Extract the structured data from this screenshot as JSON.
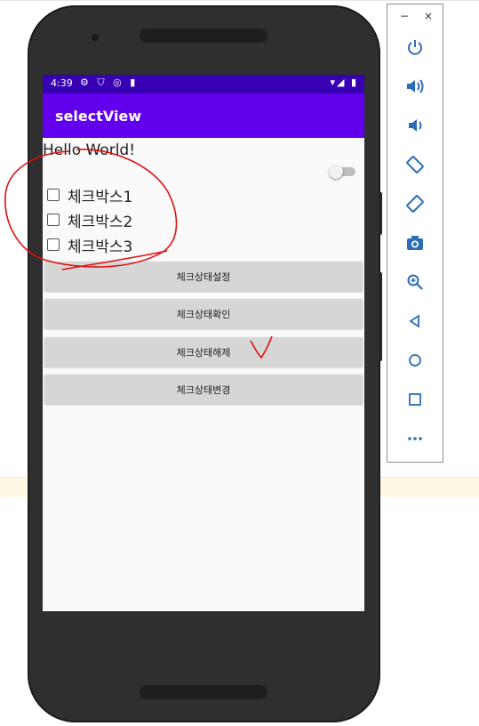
{
  "status_bar": {
    "time": "4:39",
    "left_icons": "⚙ ⛉ ◎ ▮",
    "right_icons": "▾◢ ▮"
  },
  "app": {
    "title": "selectView"
  },
  "content": {
    "hello_text": "Hello World!",
    "switch_on": false,
    "checkboxes": [
      {
        "label": "체크박스1",
        "checked": false
      },
      {
        "label": "체크박스2",
        "checked": false
      },
      {
        "label": "체크박스3",
        "checked": false
      }
    ],
    "buttons": [
      {
        "label": "체크상태설정"
      },
      {
        "label": "체크상태확인"
      },
      {
        "label": "체크상태해제"
      },
      {
        "label": "체크상태변경"
      }
    ]
  },
  "emulator_toolbar": {
    "minimize_label": "−",
    "close_label": "×",
    "buttons": [
      {
        "icon": "power-icon"
      },
      {
        "icon": "volume-up-icon"
      },
      {
        "icon": "volume-down-icon"
      },
      {
        "icon": "rotate-left-icon"
      },
      {
        "icon": "rotate-right-icon"
      },
      {
        "icon": "camera-icon"
      },
      {
        "icon": "zoom-icon"
      },
      {
        "icon": "back-icon"
      },
      {
        "icon": "home-icon"
      },
      {
        "icon": "overview-icon"
      },
      {
        "icon": "more-icon"
      }
    ]
  },
  "colors": {
    "status_bar": "#3700b3",
    "app_bar": "#6200ee",
    "annotation": "#e01010",
    "button_bg": "#d6d6d6"
  }
}
